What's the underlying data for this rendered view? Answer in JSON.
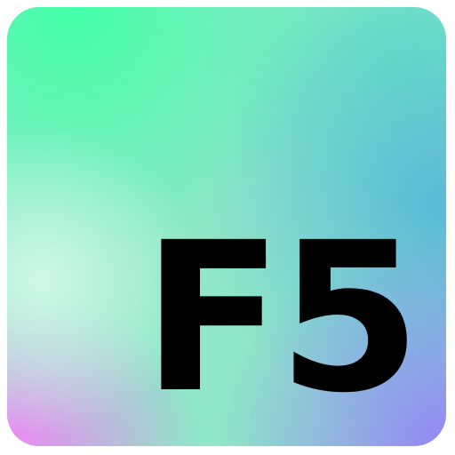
{
  "icon": {
    "label": "F5",
    "text_color": "#000000",
    "gradient_colors": {
      "top_left": "#42ffa8",
      "right": "#5bb8d8",
      "bottom_right": "#9485f7",
      "bottom_left": "#ee86f4",
      "center_left": "#d7faeb"
    }
  }
}
